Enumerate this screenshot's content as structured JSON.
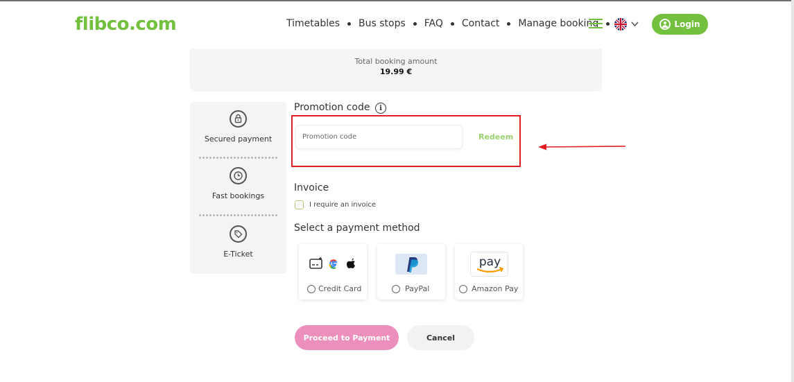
{
  "header": {
    "logo": "flibco.com",
    "nav": [
      "Timetables",
      "Bus stops",
      "FAQ",
      "Contact",
      "Manage booking"
    ],
    "login_label": "Login"
  },
  "summary": {
    "total_label": "Total booking amount",
    "total_value": "19.99 €"
  },
  "features": [
    {
      "label": "Secured payment",
      "icon": "lock-icon"
    },
    {
      "label": "Fast bookings",
      "icon": "clock-icon"
    },
    {
      "label": "E-Ticket",
      "icon": "tag-icon"
    }
  ],
  "promotion": {
    "title": "Promotion code",
    "placeholder": "Promotion code",
    "redeem_label": "Redeem"
  },
  "invoice": {
    "title": "Invoice",
    "checkbox_label": "I require an invoice"
  },
  "payment": {
    "title": "Select a payment method",
    "methods": [
      {
        "label": "Credit Card",
        "icon": "credit-card-google-apple-icons"
      },
      {
        "label": "PayPal",
        "icon": "paypal-icon"
      },
      {
        "label": "Amazon Pay",
        "icon": "amazon-pay-icon"
      }
    ]
  },
  "actions": {
    "proceed_label": "Proceed to Payment",
    "cancel_label": "Cancel"
  },
  "colors": {
    "brand_green": "#73c03f",
    "proceed_pink": "#ec8fbc",
    "highlight_red": "#e11b22"
  }
}
